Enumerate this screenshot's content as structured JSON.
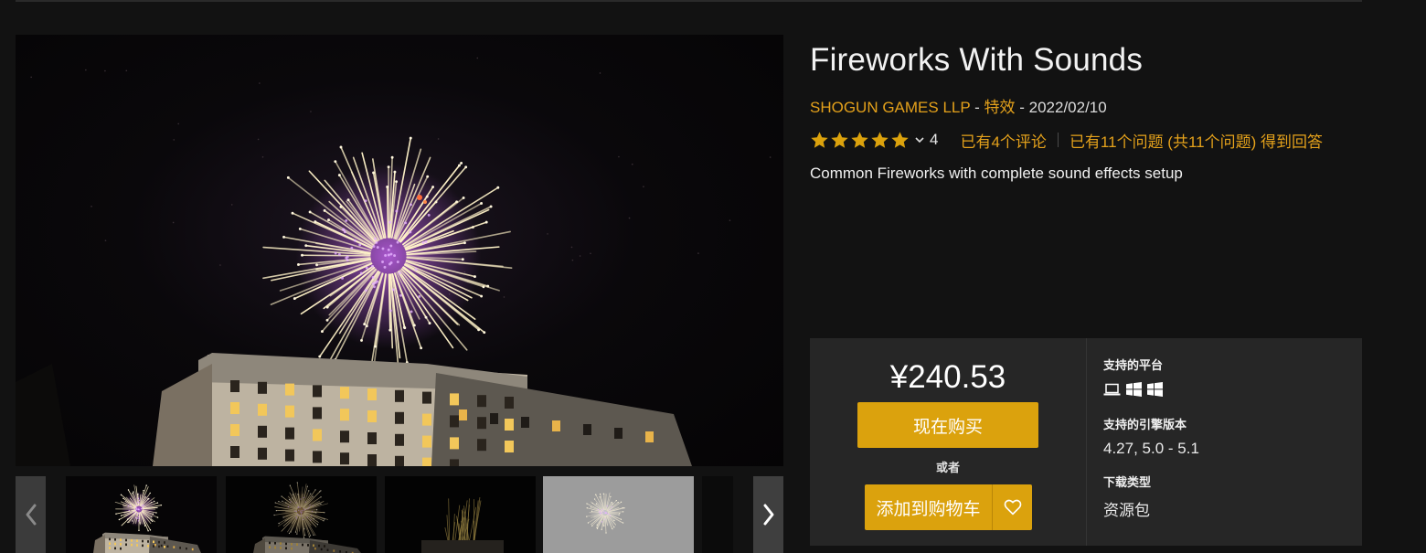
{
  "product": {
    "title": "Fireworks With Sounds",
    "publisher": "SHOGUN GAMES LLP",
    "separator1": " - ",
    "category": "特效",
    "separator2": " - ",
    "date": "2022/02/10",
    "rating_stars": 5,
    "rating_count": "4",
    "reviews_link": "已有4个评论",
    "questions_link": "已有11个问题 (共11个问题) 得到回答",
    "description": "Common Fireworks with complete sound effects setup"
  },
  "purchase": {
    "price": "¥240.53",
    "buy_now_label": "现在购买",
    "or_label": "或者",
    "add_to_cart_label": "添加到购物车"
  },
  "specs": {
    "platforms_label": "支持的平台",
    "platform_icons": [
      "laptop-icon",
      "windows-icon",
      "windows-icon"
    ],
    "engine_label": "支持的引擎版本",
    "engine_value": "4.27, 5.0 - 5.1",
    "download_type_label": "下载类型",
    "download_type_value": "资源包"
  },
  "gallery": {
    "thumbnails": [
      {
        "name": "thumbnail-1",
        "scene": "purple-firework-over-building",
        "active": true
      },
      {
        "name": "thumbnail-2",
        "scene": "gold-firework",
        "active": false
      },
      {
        "name": "thumbnail-3",
        "scene": "rising-sparks",
        "active": false
      },
      {
        "name": "thumbnail-4",
        "scene": "grey-burst",
        "active": false
      }
    ]
  },
  "colors": {
    "accent": "#dba20d",
    "link": "#e4a11b",
    "background": "#121212",
    "panel": "#262626"
  }
}
